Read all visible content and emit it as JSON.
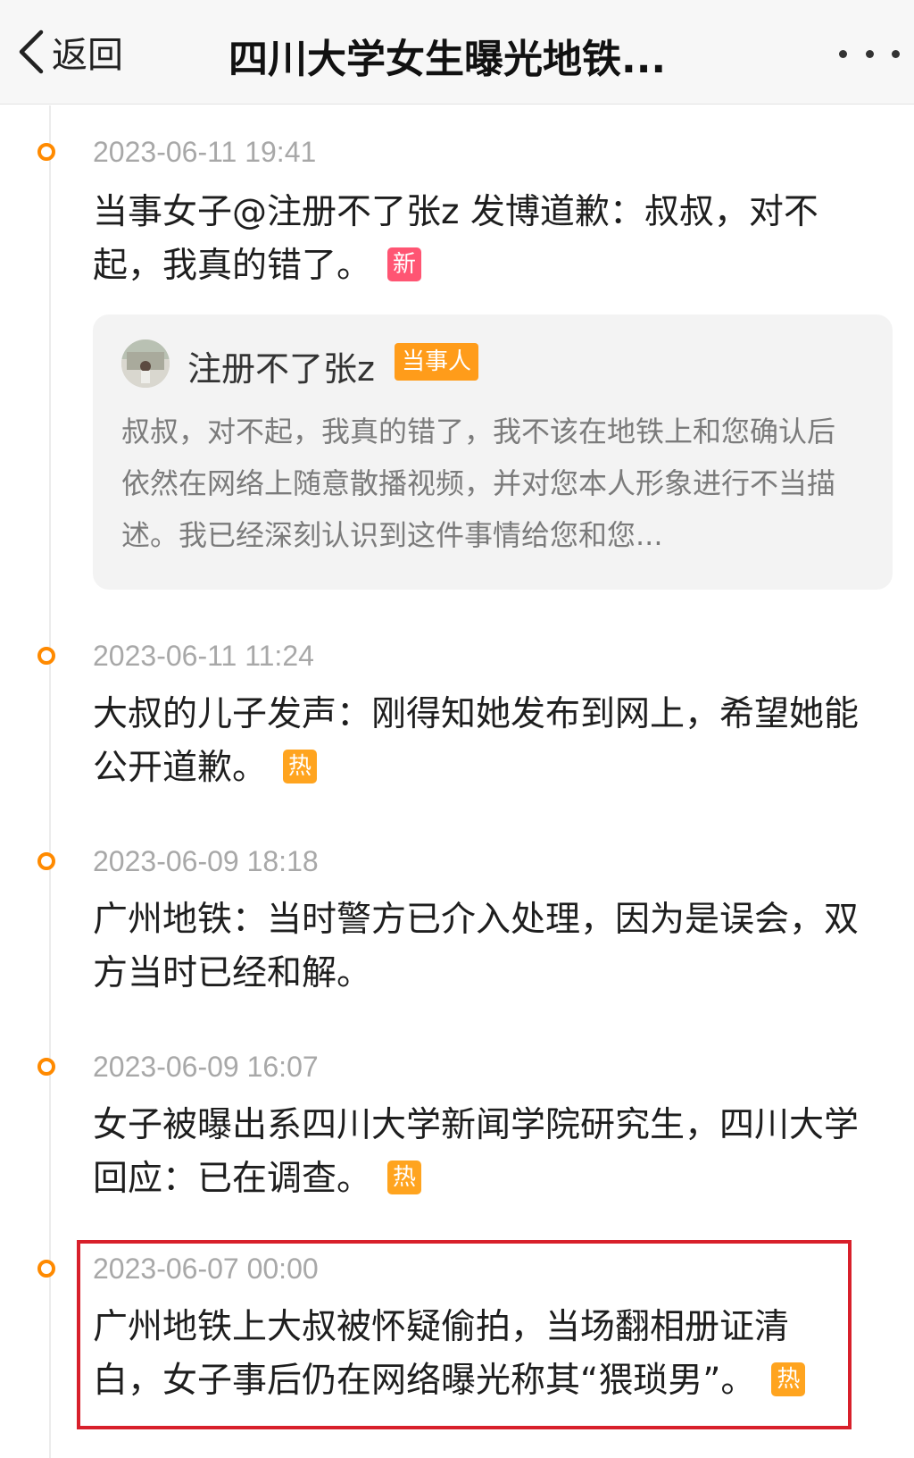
{
  "header": {
    "back_label": "返回",
    "title": "四川大学女生曝光地铁...",
    "more_icon": "more-dots-icon"
  },
  "colors": {
    "accent_orange": "#ff8a00",
    "badge_new": "#ff5573",
    "badge_hot": "#ffa41f",
    "highlight_red": "#d8202b"
  },
  "timeline": [
    {
      "time": "2023-06-11 19:41",
      "text": "当事女子@注册不了张z 发博道歉：叔叔，对不起，我真的错了。",
      "badge": "新",
      "quote": {
        "user": "注册不了张z",
        "role": "当事人",
        "text": "叔叔，对不起，我真的错了，我不该在地铁上和您确认后依然在网络上随意散播视频，并对您本人形象进行不当描述。我已经深刻认识到这件事情给您和您..."
      }
    },
    {
      "time": "2023-06-11 11:24",
      "text": "大叔的儿子发声：刚得知她发布到网上，希望她能公开道歉。",
      "badge": "热"
    },
    {
      "time": "2023-06-09 18:18",
      "text": "广州地铁：当时警方已介入处理，因为是误会，双方当时已经和解。"
    },
    {
      "time": "2023-06-09 16:07",
      "text": "女子被曝出系四川大学新闻学院研究生，四川大学回应：已在调查。",
      "badge": "热"
    },
    {
      "time": "2023-06-07 00:00",
      "text": "广州地铁上大叔被怀疑偷拍，当场翻相册证清白，女子事后仍在网络曝光称其“猥琐男”。",
      "badge": "热",
      "highlighted": true
    }
  ]
}
